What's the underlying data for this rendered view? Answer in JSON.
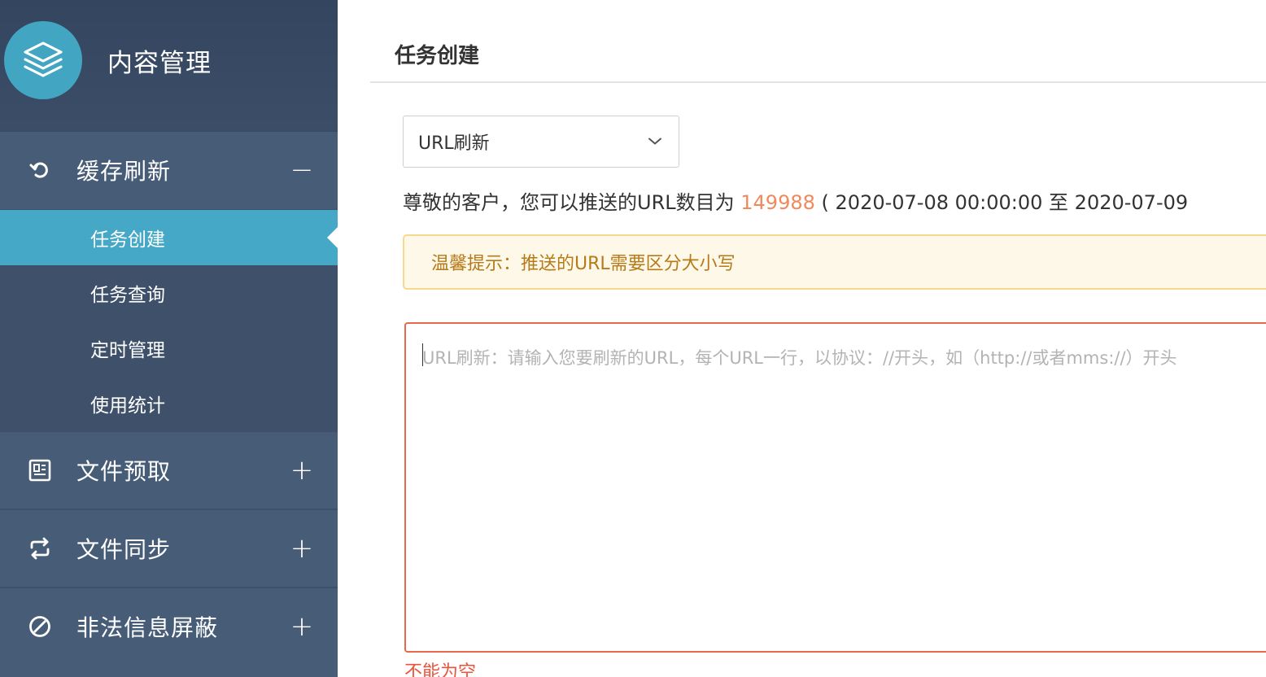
{
  "sidebar": {
    "brand_title": "内容管理",
    "groups": [
      {
        "label": "缓存刷新",
        "toggle": "−",
        "icon": "refresh-icon",
        "expanded": true,
        "items": [
          {
            "label": "任务创建",
            "active": true
          },
          {
            "label": "任务查询"
          },
          {
            "label": "定时管理"
          },
          {
            "label": "使用统计"
          }
        ]
      },
      {
        "label": "文件预取",
        "toggle": "+",
        "icon": "prefetch-icon"
      },
      {
        "label": "文件同步",
        "toggle": "+",
        "icon": "sync-icon"
      },
      {
        "label": "非法信息屏蔽",
        "toggle": "+",
        "icon": "block-icon"
      }
    ]
  },
  "main": {
    "title": "任务创建",
    "select_value": "URL刷新",
    "quota_prefix": "尊敬的客户，您可以推送的URL数目为",
    "quota_number": "149988",
    "quota_suffix": "( 2020-07-08 00:00:00 至 2020-07-09",
    "notice": "温馨提示：推送的URL需要区分大小写",
    "textarea_placeholder": "URL刷新：请输入您要刷新的URL，每个URL一行，以协议：//开头，如（http://或者mms://）开头",
    "error": "不能为空"
  },
  "colors": {
    "sidebar_bg": "#475c76",
    "accent": "#45a8c7",
    "highlight_number": "#f0895c",
    "error": "#e9543c",
    "notice_text": "#b67a18"
  }
}
